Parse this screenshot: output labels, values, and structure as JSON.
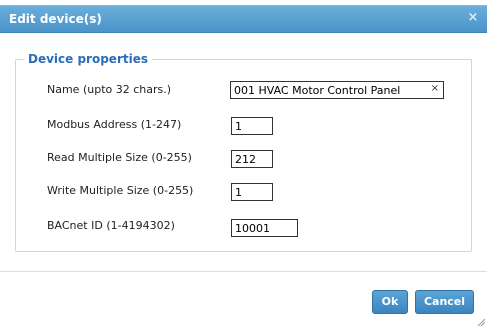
{
  "dialog": {
    "title": "Edit device(s)",
    "close_glyph": "×",
    "section_legend": "Device properties",
    "fields": {
      "name": {
        "label": "Name (upto 32 chars.)",
        "value": "001 HVAC Motor Control Panel",
        "clear_glyph": "×"
      },
      "modbus": {
        "label": "Modbus Address (1-247)",
        "value": "1"
      },
      "read": {
        "label": "Read Multiple Size (0-255)",
        "value": "212"
      },
      "write": {
        "label": "Write Multiple Size (0-255)",
        "value": "1"
      },
      "bacnet": {
        "label": "BACnet ID (1-4194302)",
        "value": "10001"
      }
    },
    "buttons": {
      "ok": "Ok",
      "cancel": "Cancel"
    }
  },
  "colors": {
    "titlebar": "#4a94c9",
    "legend": "#2a6ebb",
    "button": "#3b85bf"
  }
}
